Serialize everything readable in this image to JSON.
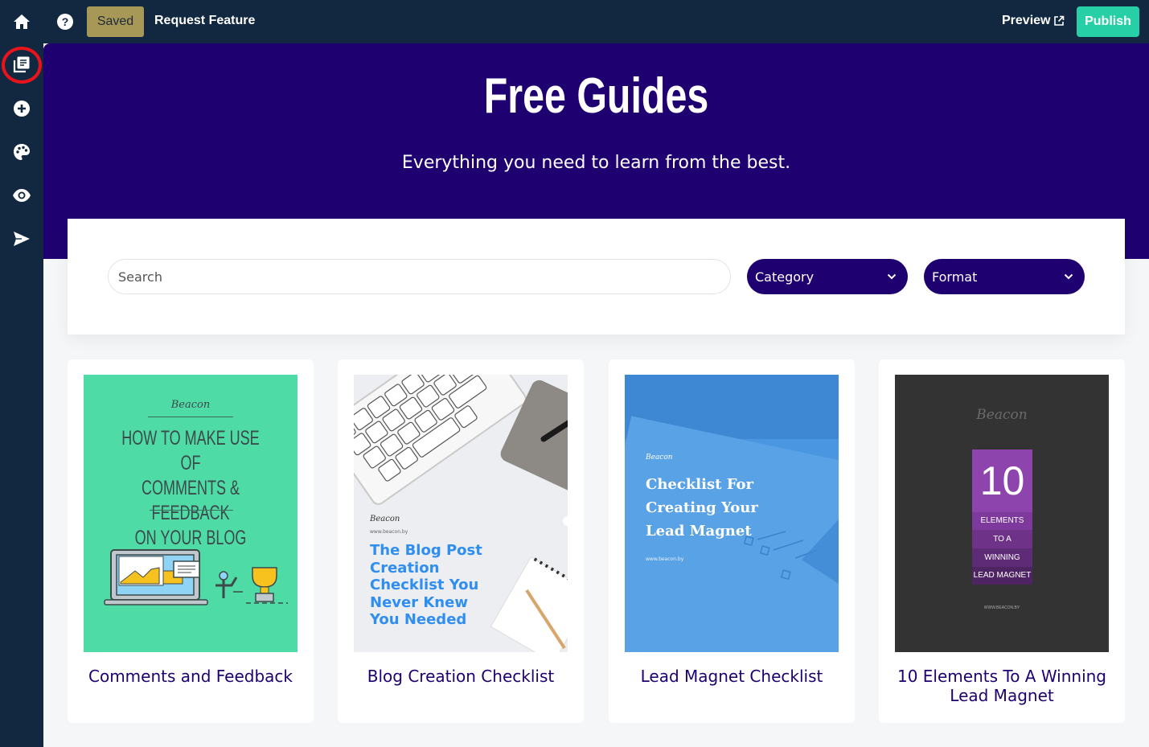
{
  "topbar": {
    "home_icon": "home-icon",
    "help_icon": "help-circle-icon",
    "saved_label": "Saved",
    "request_feature_label": "Request Feature",
    "preview_label": "Preview",
    "preview_icon": "external-link-icon",
    "publish_label": "Publish"
  },
  "sidebar": {
    "items": [
      {
        "name": "pages",
        "icon": "pages-icon",
        "highlighted": true
      },
      {
        "name": "add",
        "icon": "plus-circle-icon"
      },
      {
        "name": "theme",
        "icon": "palette-icon"
      },
      {
        "name": "visibility",
        "icon": "eye-icon"
      },
      {
        "name": "publish",
        "icon": "send-icon"
      }
    ]
  },
  "hero": {
    "title": "Free Guides",
    "subtitle": "Everything you need to learn from the best."
  },
  "filters": {
    "search_placeholder": "Search",
    "category_label": "Category",
    "format_label": "Format"
  },
  "cards": [
    {
      "title": "Comments and Feedback",
      "cover": {
        "brand": "Beacon",
        "lines": [
          "HOW TO MAKE USE OF",
          "COMMENTS & FEEDBACK",
          "ON YOUR BLOG"
        ],
        "bg": "#4fdba6"
      }
    },
    {
      "title": "Blog Creation Checklist",
      "cover": {
        "brand": "Beacon",
        "url": "www.beacon.by",
        "lines": [
          "The Blog Post",
          "Creation",
          "Checklist You",
          "Never Knew",
          "You Needed"
        ],
        "bg": "#eceef1",
        "accent": "#2f8ef0"
      }
    },
    {
      "title": "Lead Magnet Checklist",
      "cover": {
        "brand": "Beacon",
        "url": "www.beacon.by",
        "lines": [
          "Checklist For",
          "Creating Your",
          "Lead Magnet"
        ],
        "bg": "#4a96e0"
      }
    },
    {
      "title": "10 Elements To A Winning Lead Magnet",
      "cover": {
        "brand": "Beacon",
        "number": "10",
        "lines": [
          "ELEMENTS",
          "TO A",
          "WINNING",
          "LEAD MAGNET"
        ],
        "url": "WWW.BEACON.BY",
        "bg": "#333333"
      }
    }
  ],
  "colors": {
    "nav_bg": "#122841",
    "hero_bg": "#1f0070",
    "publish": "#26cfa6",
    "saved": "#a89858",
    "annotation": "#e8141c"
  }
}
